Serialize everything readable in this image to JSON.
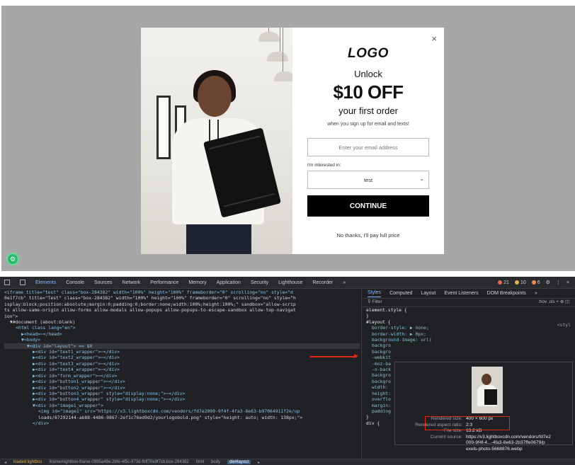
{
  "popup": {
    "close_glyph": "×",
    "logo": "LOGO",
    "unlock": "Unlock",
    "offer": "$10 OFF",
    "subtitle": "your first order",
    "note": "when you sign up for email and texts!",
    "email_placeholder": "Enter your email address",
    "interest_label": "I'm interested in:",
    "interest_value": "test",
    "continue_label": "CONTINUE",
    "decline_label": "No thanks, I'll pay full price"
  },
  "devtools": {
    "tabs": [
      "Elements",
      "Console",
      "Sources",
      "Network",
      "Performance",
      "Memory",
      "Application",
      "Security",
      "Lighthouse",
      "Recorder",
      "»"
    ],
    "badges": {
      "errors": "21",
      "warnings": "10",
      "info": "6"
    },
    "badge_colors": {
      "errors": "#e46962",
      "warnings": "#e0b450",
      "info": "#ee8e52"
    },
    "elements_lines": [
      {
        "indent": 0,
        "text": "<iframe title=\"test\" class=\"box-284382\" width=\"100%\" height=\"100%\" frameborder=\"0\" scrolling=\"no\" style=\"d"
      },
      {
        "indent": 0,
        "text": "0e1f7cb\" title=\"Test\" class=\"box-284382\" width=\"100%\" height=\"100%\" frameborder=\"0\" scrolling=\"no\" style=\"h"
      },
      {
        "indent": 0,
        "text": "isplay:block;position:absolute;margin:0;padding:0;border:none;width:100%;height:100%;\" sandbox=\"allow-scrip"
      },
      {
        "indent": 0,
        "text": "ts allow-same-origin allow-forms allow-modals allow-popups allow-popups-to-escape-sandbox allow-top-navigat"
      },
      {
        "indent": 0,
        "text": "ion\">"
      },
      {
        "indent": 1,
        "text": "▼#document (about:blank)"
      },
      {
        "indent": 2,
        "text": "<html class lang=\"en\">"
      },
      {
        "indent": 3,
        "text": "▶<head>⋯</head>"
      },
      {
        "indent": 3,
        "text": "▼<body>"
      },
      {
        "indent": 4,
        "text": "▼<div id=\"layout\"> == $0",
        "selected": true
      },
      {
        "indent": 5,
        "text": "▶<div id=\"text1_wrapper\">⋯</div>"
      },
      {
        "indent": 5,
        "text": "▶<div id=\"text2_wrapper\">⋯</div>"
      },
      {
        "indent": 5,
        "text": "▶<div id=\"text3_wrapper\">⋯</div>"
      },
      {
        "indent": 5,
        "text": "▶<div id=\"text4_wrapper\">⋯</div>"
      },
      {
        "indent": 5,
        "text": "▶<div id=\"form_wrapper\">⋯</div>"
      },
      {
        "indent": 5,
        "text": "▶<div id=\"button1_wrapper\">⋯</div>"
      },
      {
        "indent": 5,
        "text": "▶<div id=\"button2_wrapper\">⋯</div>"
      },
      {
        "indent": 5,
        "text": "▶<div id=\"button3_wrapper\" style=\"display:none;\">⋯</div>"
      },
      {
        "indent": 5,
        "text": "▶<div id=\"button4_wrapper\" style=\"display:none;\">⋯</div>"
      },
      {
        "indent": 5,
        "text": "▼<div id=\"image1_wrapper\">"
      },
      {
        "indent": 6,
        "text": "<img id=\"image1\" src=\"https://v3.lightboxcdn.com/vendors/fd7e2009-9f4f-4fa3-8e63-b97064911f2e/up"
      },
      {
        "indent": 6,
        "text": "loads/67292144-ab88-4486-9867-2ef1c76ed9d2/yourlogobold.png\" style=\"height: auto; width: 138px;\">"
      },
      {
        "indent": 5,
        "text": "</div>"
      }
    ],
    "styles_tabs": [
      "Styles",
      "Computed",
      "Layout",
      "Event Listeners",
      "DOM Breakpoints",
      "»"
    ],
    "filter_placeholder": "Filter",
    "filter_tools": ":hov .cls + ⊕ ◫",
    "styles_lines": [
      {
        "text": "element.style {",
        "kind": "sel"
      },
      {
        "text": "}",
        "kind": "sel"
      },
      {
        "text": "#layout {",
        "kind": "sel"
      },
      {
        "text": "border-style: ▶ none;",
        "kind": "prop"
      },
      {
        "text": "border-width: ▶ 0px;",
        "kind": "prop"
      },
      {
        "text": "background-image: url(",
        "kind": "prop"
      },
      {
        "text": "backgro",
        "kind": "prop"
      },
      {
        "text": "backgro",
        "kind": "prop"
      },
      {
        "text": "-webkit",
        "kind": "prop"
      },
      {
        "text": "-moz-ba",
        "kind": "prop"
      },
      {
        "text": "-o-back",
        "kind": "prop"
      },
      {
        "text": "backgro",
        "kind": "prop"
      },
      {
        "text": "backgro",
        "kind": "prop"
      },
      {
        "text": "width:",
        "kind": "prop"
      },
      {
        "text": "height:",
        "kind": "prop"
      },
      {
        "text": "overflo",
        "kind": "prop"
      },
      {
        "text": "margin:",
        "kind": "prop"
      },
      {
        "text": "padding",
        "kind": "prop"
      },
      {
        "text": "}",
        "kind": "sel"
      },
      {
        "text": "div {",
        "kind": "sel"
      }
    ],
    "style_source": "<styl",
    "image_info": {
      "rendered_size_label": "Rendered size:",
      "rendered_size": "400 × 600 px",
      "aspect_label": "Rendered aspect ratio:",
      "aspect": "2:3",
      "file_size_label": "File size:",
      "file_size": "13.2 kB",
      "source_label": "Current source:",
      "source_lines": [
        "https://v3.lightboxcdn.com/vendors/fd7e2",
        "009-9f4f-4...-4fa3-8e63-2b37ffe0679/p",
        "exels-photo-5668876.webp"
      ]
    },
    "status_items": [
      "◂",
      "loaded lightbox",
      "iframe#lightbox-frame-0995a49e-2bfe-4f5c-873d-fbff70e9f7cb.box-284382",
      "html",
      "body",
      "div#layout",
      "▸"
    ]
  }
}
